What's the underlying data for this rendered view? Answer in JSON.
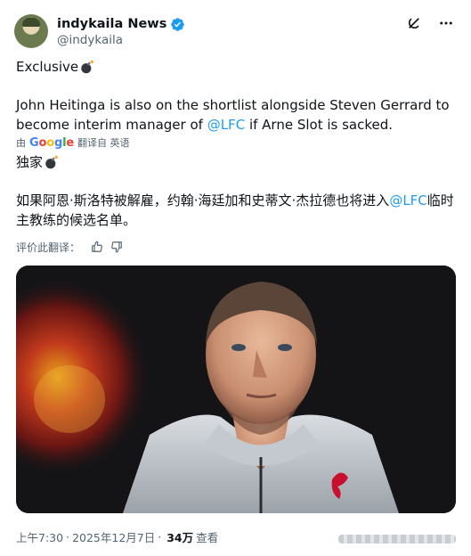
{
  "author": {
    "display_name": "indykaila News",
    "handle": "@indykaila"
  },
  "post": {
    "line_exclusive": "Exclusive",
    "body_before_mention": "John Heitinga is also on the shortlist alongside Steven Gerrard to become interim manager of ",
    "mention": "@LFC",
    "body_after_mention": " if Arne Slot is sacked."
  },
  "translation": {
    "by_prefix": "由",
    "google": [
      "G",
      "o",
      "o",
      "g",
      "l",
      "e"
    ],
    "by_suffix": "翻译自 英语",
    "line_exclusive": "独家",
    "body_before_mention": "如果阿恩·斯洛特被解雇，约翰·海廷加和史蒂文·杰拉德也将进入",
    "mention": "@LFC",
    "body_after_mention": "临时主教练的候选名单。",
    "rate_label": "评价此翻译："
  },
  "footer": {
    "time": "上午7:30",
    "date": "2025年12月7日",
    "views_count": "34万",
    "views_label": "查看"
  },
  "icons": {
    "verified": "verified-badge-icon",
    "grok": "grok-icon",
    "more": "more-icon",
    "bomb": "bomb-emoji",
    "thumbs_up": "thumbs-up-icon",
    "thumbs_down": "thumbs-down-icon"
  },
  "colors": {
    "accent": "#1d9bf0",
    "text": "#0f1419",
    "secondary": "#536471"
  }
}
